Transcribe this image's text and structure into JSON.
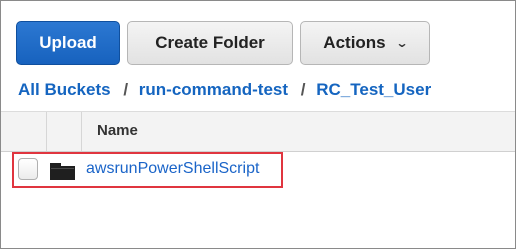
{
  "toolbar": {
    "upload_label": "Upload",
    "create_folder_label": "Create Folder",
    "actions_label": "Actions"
  },
  "breadcrumb": {
    "items": [
      "All Buckets",
      "run-command-test",
      "RC_Test_User"
    ],
    "separator": "/"
  },
  "table": {
    "columns": [
      "Name"
    ],
    "rows": [
      {
        "name": "awsrunPowerShellScript",
        "icon": "folder-icon",
        "type": "folder"
      }
    ]
  },
  "colors": {
    "primary": "#1762be",
    "link": "#1a64c8",
    "highlight": "#e0353f"
  }
}
